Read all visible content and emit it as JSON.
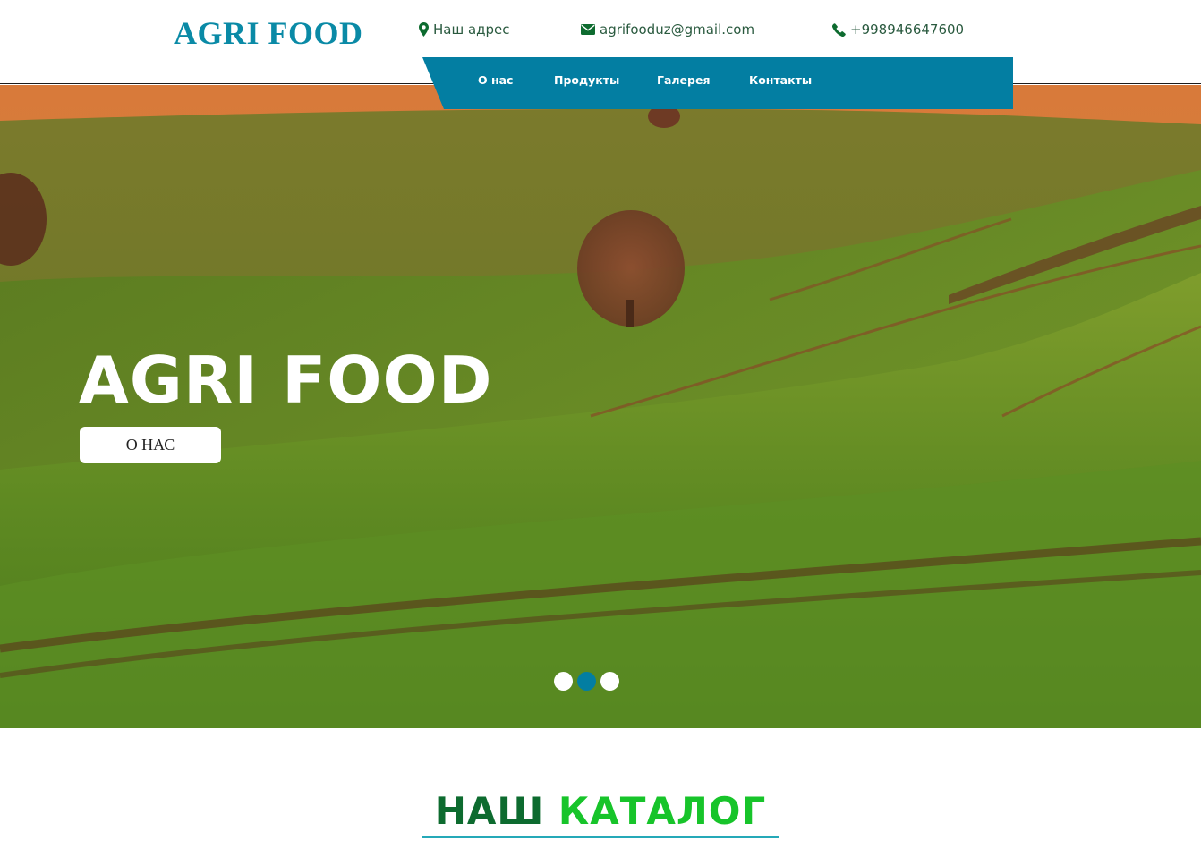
{
  "header": {
    "logo": "AGRI FOOD",
    "address_label": "Наш адрес",
    "email": "agrifooduz@gmail.com",
    "phone": "+998946647600",
    "icons": {
      "address": "map-marker-icon",
      "email": "envelope-icon",
      "phone": "phone-icon"
    }
  },
  "nav": {
    "items": [
      {
        "label": "О нас"
      },
      {
        "label": "Продукты"
      },
      {
        "label": "Галерея"
      },
      {
        "label": "Контакты"
      }
    ]
  },
  "hero": {
    "title": "AGRI FOOD",
    "button_label": "О НАС",
    "slides": 3,
    "active_slide": 2
  },
  "catalog": {
    "title_part1": "НАШ",
    "title_part2": "КАТАЛОГ"
  },
  "colors": {
    "brand_teal": "#0a8aa6",
    "nav_bg": "#037ea2",
    "catalog_dark_green": "#0d6b2f",
    "catalog_bright_green": "#17c42a",
    "contact_text": "#2a5a3f"
  }
}
